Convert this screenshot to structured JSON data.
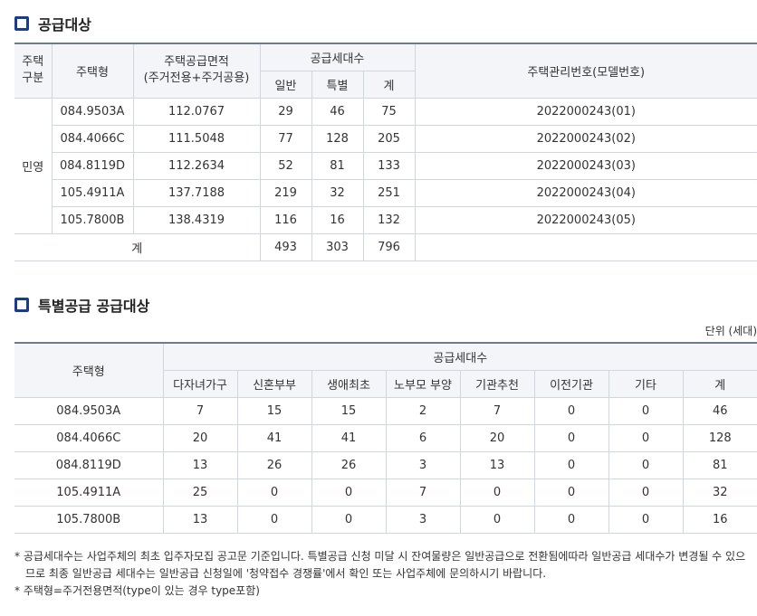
{
  "section1": {
    "title": "공급대상",
    "headers": {
      "house_class": "주택\n구분",
      "house_type": "주택형",
      "area": "주택공급면적\n(주거전용+주거공용)",
      "units": "공급세대수",
      "general": "일반",
      "special": "특별",
      "total": "계",
      "mgmt_no": "주택관리번호(모델번호)"
    },
    "class_label": "민영",
    "rows": [
      {
        "type": "084.9503A",
        "area": "112.0767",
        "general": "29",
        "special": "46",
        "total": "75",
        "mgmt": "2022000243(01)"
      },
      {
        "type": "084.4066C",
        "area": "111.5048",
        "general": "77",
        "special": "128",
        "total": "205",
        "mgmt": "2022000243(02)"
      },
      {
        "type": "084.8119D",
        "area": "112.2634",
        "general": "52",
        "special": "81",
        "total": "133",
        "mgmt": "2022000243(03)"
      },
      {
        "type": "105.4911A",
        "area": "137.7188",
        "general": "219",
        "special": "32",
        "total": "251",
        "mgmt": "2022000243(04)"
      },
      {
        "type": "105.7800B",
        "area": "138.4319",
        "general": "116",
        "special": "16",
        "total": "132",
        "mgmt": "2022000243(05)"
      }
    ],
    "sum": {
      "label": "계",
      "general": "493",
      "special": "303",
      "total": "796"
    }
  },
  "section2": {
    "title": "특별공급 공급대상",
    "unit": "단위 (세대)",
    "headers": {
      "house_type": "주택형",
      "units": "공급세대수",
      "cols": [
        "다자녀가구",
        "신혼부부",
        "생애최초",
        "노부모 부양",
        "기관추천",
        "이전기관",
        "기타",
        "계"
      ]
    },
    "rows": [
      {
        "type": "084.9503A",
        "values": [
          "7",
          "15",
          "15",
          "2",
          "7",
          "0",
          "0",
          "46"
        ]
      },
      {
        "type": "084.4066C",
        "values": [
          "20",
          "41",
          "41",
          "6",
          "20",
          "0",
          "0",
          "128"
        ]
      },
      {
        "type": "084.8119D",
        "values": [
          "13",
          "26",
          "26",
          "3",
          "13",
          "0",
          "0",
          "81"
        ]
      },
      {
        "type": "105.4911A",
        "values": [
          "25",
          "0",
          "0",
          "7",
          "0",
          "0",
          "0",
          "32"
        ]
      },
      {
        "type": "105.7800B",
        "values": [
          "13",
          "0",
          "0",
          "3",
          "0",
          "0",
          "0",
          "16"
        ]
      }
    ]
  },
  "notes": [
    "* 공급세대수는 사업주체의 최초 입주자모집 공고문 기준입니다. 특별공급 신청 미달 시 잔여물량은 일반공급으로 전환됨에따라 일반공급 세대수가 변경될 수 있으므로 최종 일반공급 세대수는 일반공급 신청일에 '청약접수 경쟁률'에서 확인 또는 사업주체에 문의하시기 바랍니다.",
    "* 주택형=주거전용면적(type이 있는 경우 type포함)"
  ]
}
